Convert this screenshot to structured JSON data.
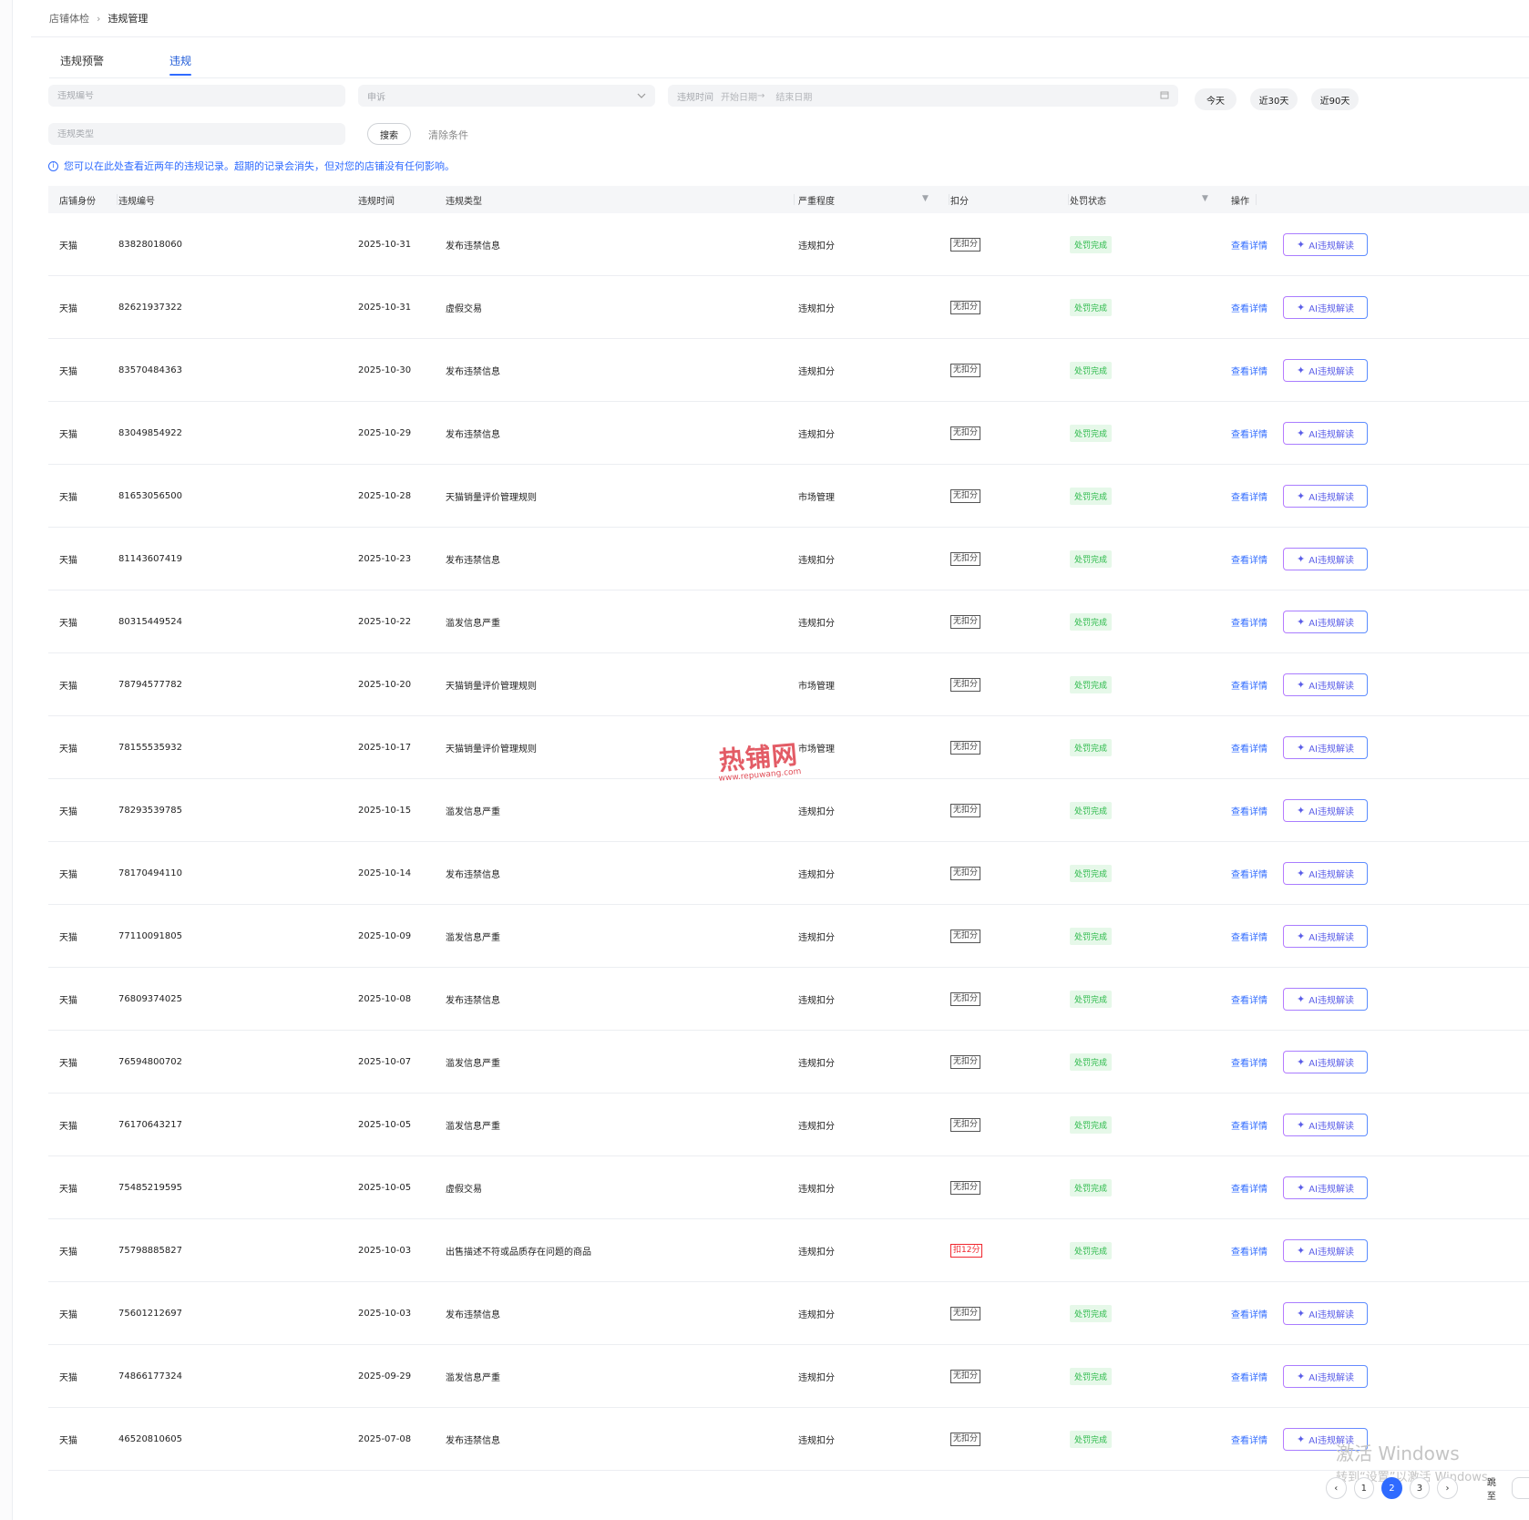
{
  "breadcrumb": {
    "parent": "店铺体检",
    "separator": "›",
    "current": "违规管理"
  },
  "tabs": [
    {
      "label": "违规预警",
      "active": false
    },
    {
      "label": "违规",
      "active": true
    }
  ],
  "filters": {
    "violation_id_placeholder": "违规编号",
    "appeal_placeholder": "申诉",
    "date_label": "违规时间",
    "start_date_placeholder": "开始日期",
    "date_arrow": "→",
    "end_date_placeholder": "结束日期",
    "violation_type_placeholder": "违规类型",
    "quick_ranges": [
      "今天",
      "近30天",
      "近90天"
    ],
    "search_label": "搜索",
    "clear_label": "清除条件"
  },
  "notice": "您可以在此处查看近两年的违规记录。超期的记录会消失，但对您的店铺没有任何影响。",
  "table": {
    "headers": {
      "shop_identity": "店铺身份",
      "violation_id": "违规编号",
      "violation_time": "违规时间",
      "violation_type": "违规类型",
      "severity": "严重程度",
      "deduction": "扣分",
      "status": "处罚状态",
      "actions": "操作"
    },
    "detail_label": "查看详情",
    "ai_label": "AI违规解读",
    "rows": [
      {
        "shop": "天猫",
        "id": "83828018060",
        "date": "2025-10-31",
        "type": "发布违禁信息",
        "severity": "违规扣分",
        "deduction": "无扣分",
        "status": "处罚完成"
      },
      {
        "shop": "天猫",
        "id": "82621937322",
        "date": "2025-10-31",
        "type": "虚假交易",
        "severity": "违规扣分",
        "deduction": "无扣分",
        "status": "处罚完成"
      },
      {
        "shop": "天猫",
        "id": "83570484363",
        "date": "2025-10-30",
        "type": "发布违禁信息",
        "severity": "违规扣分",
        "deduction": "无扣分",
        "status": "处罚完成"
      },
      {
        "shop": "天猫",
        "id": "83049854922",
        "date": "2025-10-29",
        "type": "发布违禁信息",
        "severity": "违规扣分",
        "deduction": "无扣分",
        "status": "处罚完成"
      },
      {
        "shop": "天猫",
        "id": "81653056500",
        "date": "2025-10-28",
        "type": "天猫销量评价管理规则",
        "severity": "市场管理",
        "deduction": "无扣分",
        "status": "处罚完成"
      },
      {
        "shop": "天猫",
        "id": "81143607419",
        "date": "2025-10-23",
        "type": "发布违禁信息",
        "severity": "违规扣分",
        "deduction": "无扣分",
        "status": "处罚完成"
      },
      {
        "shop": "天猫",
        "id": "80315449524",
        "date": "2025-10-22",
        "type": "滥发信息严重",
        "severity": "违规扣分",
        "deduction": "无扣分",
        "status": "处罚完成"
      },
      {
        "shop": "天猫",
        "id": "78794577782",
        "date": "2025-10-20",
        "type": "天猫销量评价管理规则",
        "severity": "市场管理",
        "deduction": "无扣分",
        "status": "处罚完成"
      },
      {
        "shop": "天猫",
        "id": "78155535932",
        "date": "2025-10-17",
        "type": "天猫销量评价管理规则",
        "severity": "市场管理",
        "deduction": "无扣分",
        "status": "处罚完成"
      },
      {
        "shop": "天猫",
        "id": "78293539785",
        "date": "2025-10-15",
        "type": "滥发信息严重",
        "severity": "违规扣分",
        "deduction": "无扣分",
        "status": "处罚完成"
      },
      {
        "shop": "天猫",
        "id": "78170494110",
        "date": "2025-10-14",
        "type": "发布违禁信息",
        "severity": "违规扣分",
        "deduction": "无扣分",
        "status": "处罚完成"
      },
      {
        "shop": "天猫",
        "id": "77110091805",
        "date": "2025-10-09",
        "type": "滥发信息严重",
        "severity": "违规扣分",
        "deduction": "无扣分",
        "status": "处罚完成"
      },
      {
        "shop": "天猫",
        "id": "76809374025",
        "date": "2025-10-08",
        "type": "发布违禁信息",
        "severity": "违规扣分",
        "deduction": "无扣分",
        "status": "处罚完成"
      },
      {
        "shop": "天猫",
        "id": "76594800702",
        "date": "2025-10-07",
        "type": "滥发信息严重",
        "severity": "违规扣分",
        "deduction": "无扣分",
        "status": "处罚完成"
      },
      {
        "shop": "天猫",
        "id": "76170643217",
        "date": "2025-10-05",
        "type": "滥发信息严重",
        "severity": "违规扣分",
        "deduction": "无扣分",
        "status": "处罚完成"
      },
      {
        "shop": "天猫",
        "id": "75485219595",
        "date": "2025-10-05",
        "type": "虚假交易",
        "severity": "违规扣分",
        "deduction": "无扣分",
        "status": "处罚完成"
      },
      {
        "shop": "天猫",
        "id": "75798885827",
        "date": "2025-10-03",
        "type": "出售描述不符或品质存在问题的商品",
        "severity": "违规扣分",
        "deduction": "扣12分",
        "status": "处罚完成",
        "penalized": true
      },
      {
        "shop": "天猫",
        "id": "75601212697",
        "date": "2025-10-03",
        "type": "发布违禁信息",
        "severity": "违规扣分",
        "deduction": "无扣分",
        "status": "处罚完成"
      },
      {
        "shop": "天猫",
        "id": "74866177324",
        "date": "2025-09-29",
        "type": "滥发信息严重",
        "severity": "违规扣分",
        "deduction": "无扣分",
        "status": "处罚完成"
      },
      {
        "shop": "天猫",
        "id": "46520810605",
        "date": "2025-07-08",
        "type": "发布违禁信息",
        "severity": "违规扣分",
        "deduction": "无扣分",
        "status": "处罚完成"
      }
    ]
  },
  "pagination": {
    "pages": [
      "1",
      "2",
      "3"
    ],
    "current": "2",
    "prev": "‹",
    "next": "›",
    "jump_label": "跳至"
  },
  "watermark": {
    "main": "热铺网",
    "sub": "www.repuwang.com"
  },
  "windows_activation": {
    "title": "激活 Windows",
    "subtitle": "转到“设置”以激活 Windows。"
  },
  "colors": {
    "accent": "#2f6bff",
    "status_green": "#2cba4a",
    "penalty_red": "#f0262e"
  },
  "icons": {
    "info": "info-icon",
    "sparkle": "sparkle-icon",
    "calendar": "calendar-icon",
    "filter": "filter-icon",
    "chevron": "chevron-down-icon"
  }
}
